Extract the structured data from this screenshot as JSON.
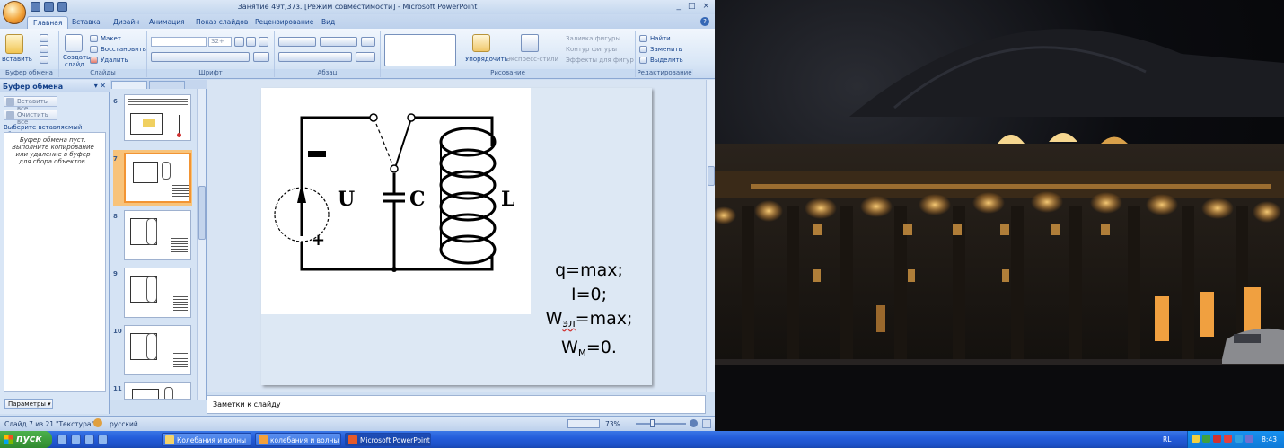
{
  "window": {
    "title": "Занятие 49т,37з. [Режим совместимости] - Microsoft PowerPoint",
    "controls": [
      "_",
      "□",
      "×"
    ]
  },
  "tabs": [
    "Главная",
    "Вставка",
    "Дизайн",
    "Анимация",
    "Показ слайдов",
    "Рецензирование",
    "Вид"
  ],
  "ribbon": {
    "clipboard": {
      "paste": "Вставить",
      "label": "Буфер обмена"
    },
    "slides": {
      "create": "Создать",
      "create2": "слайд",
      "layout": "Макет",
      "restore": "Восстановить",
      "delete": "Удалить",
      "label": "Слайды"
    },
    "font": {
      "size": "32+",
      "label": "Шрифт"
    },
    "paragraph": {
      "label": "Абзац"
    },
    "drawing": {
      "arrange": "Упорядочить",
      "styles": "Экспресс-стили",
      "fill": "Заливка фигуры",
      "outline": "Контур фигуры",
      "effects": "Эффекты для фигур",
      "label": "Рисование"
    },
    "editing": {
      "find": "Найти",
      "replace": "Заменить",
      "select": "Выделить",
      "label": "Редактирование"
    }
  },
  "clipboard_pane": {
    "title": "Буфер обмена",
    "paste_all": "Вставить все",
    "clear_all": "Очистить все",
    "choose_label": "Выберите вставляемый объект:",
    "empty_msg": "Буфер обмена пуст. Выполните копирование или удаление в буфер для сбора объектов.",
    "params": "Параметры"
  },
  "thumbnails": [
    "6",
    "7",
    "8",
    "9",
    "10",
    "11"
  ],
  "slide": {
    "labels": {
      "u": "U",
      "c": "C",
      "l": "L",
      "minus": "–",
      "plus": "+"
    },
    "formulas": {
      "q": "q=max;",
      "i": "I=0;",
      "w_base": "W",
      "w_el_sub": "эл",
      "w_el_val": "=max;",
      "w_m_sub": "м",
      "w_m_val": "=0."
    }
  },
  "notes": {
    "placeholder": "Заметки к слайду"
  },
  "status": {
    "slide": "Слайд 7 из 21",
    "theme": "\"Текстура\"",
    "lang": "русский",
    "zoom": "73%"
  },
  "taskbar": {
    "start": "пуск",
    "tasks": [
      "Колебания и волны",
      "колебания и волны ...",
      "Microsoft PowerPoint ..."
    ],
    "lang": "RL",
    "clock": "8:43"
  }
}
